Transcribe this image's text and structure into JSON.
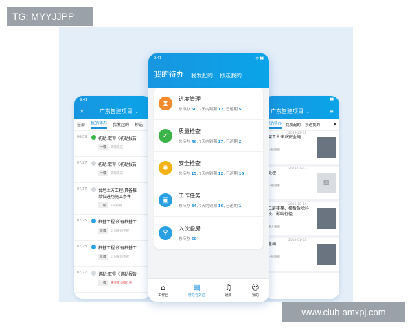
{
  "watermark_tl": "TG: MYYJJPP",
  "watermark_br": "www.club-amxpj.com",
  "colors": {
    "brand": "#1a8fdb",
    "orange": "#f28a30",
    "green": "#3bb54a",
    "yellow": "#f3b314",
    "blue": "#2aa0e4"
  },
  "center": {
    "time": "9:41",
    "tabs": [
      "我的待办",
      "我发起的",
      "抄送我的"
    ],
    "cards": [
      {
        "name": "进度管理",
        "icon": "hourglass-icon",
        "color": "#f28a30",
        "total_label": "总待办",
        "total": "50",
        "soon_label": "7天内到期",
        "soon": "12",
        "over_label": "已逾期",
        "over": "5"
      },
      {
        "name": "质量检查",
        "icon": "check-icon",
        "color": "#3bb54a",
        "total_label": "总待办",
        "total": "46",
        "soon_label": "7天内到期",
        "soon": "17",
        "over_label": "已逾期",
        "over": "2"
      },
      {
        "name": "安全检查",
        "icon": "lightbulb-icon",
        "color": "#f3b314",
        "total_label": "总待办",
        "total": "15",
        "soon_label": "7天内到期",
        "soon": "12",
        "over_label": "已逾期",
        "over": "16"
      },
      {
        "name": "工作任务",
        "icon": "briefcase-icon",
        "color": "#2aa0e4",
        "total_label": "总待办",
        "total": "34",
        "soon_label": "7天内到期",
        "soon": "16",
        "over_label": "已逾期",
        "over": "1"
      },
      {
        "name": "入伙验房",
        "icon": "key-icon",
        "color": "#2aa0e4",
        "total_label": "总待办",
        "total": "50"
      }
    ],
    "bottom_tabs": [
      {
        "label": "工作台",
        "icon": "house-icon"
      },
      {
        "label": "待办与关注",
        "icon": "document-icon"
      },
      {
        "label": "通知",
        "icon": "bell-icon"
      },
      {
        "label": "我的",
        "icon": "person-icon"
      }
    ]
  },
  "left": {
    "time": "9:41",
    "close": "✕",
    "title": "广东智建项目",
    "tabs": [
      "全部",
      "我的待办",
      "我发起的",
      "抄送"
    ],
    "items": [
      {
        "date": "06/09",
        "text": "初勘:取得《初勘报告",
        "chip": "一级",
        "meta": "实际完成"
      },
      {
        "date": "07/27",
        "text": "初勘:取得《初勘报告",
        "chip": "一级",
        "meta": "实际完成"
      },
      {
        "date": "07/17",
        "text": "台地土方工程:具备桩",
        "text2": "单位进场施工条件",
        "chip": "二级",
        "meta": "7天到期"
      },
      {
        "date": "07/25",
        "text": "桩基工程:所有桩基工",
        "chip": "三级",
        "meta": "计划天后完成"
      },
      {
        "date": "07/25",
        "text": "桩基工程:所有桩基工",
        "chip": "三级",
        "meta": "计划天后完成"
      },
      {
        "date": "07/27",
        "text": "详勘:取得《详勘报告",
        "chip": "一级",
        "meta": "未完成·超期1天"
      }
    ]
  },
  "right": {
    "title": "广东智建项目",
    "tabs": [
      "我的待办",
      "我发起的",
      "抄送我的"
    ],
    "items": [
      {
        "text": "架工人未系安全绳",
        "date": "2019-12-31",
        "hz": "一般隐患"
      },
      {
        "text": "处理",
        "date": "2018-01-02",
        "hz": "一般隐患"
      },
      {
        "text": "二层楼梯、模板拆除科技、影响行径",
        "date": "2019-10-14",
        "hz": "重大隐患"
      },
      {
        "text": "全绳",
        "date": "2018-01-02",
        "hz": "一般隐患"
      }
    ]
  }
}
